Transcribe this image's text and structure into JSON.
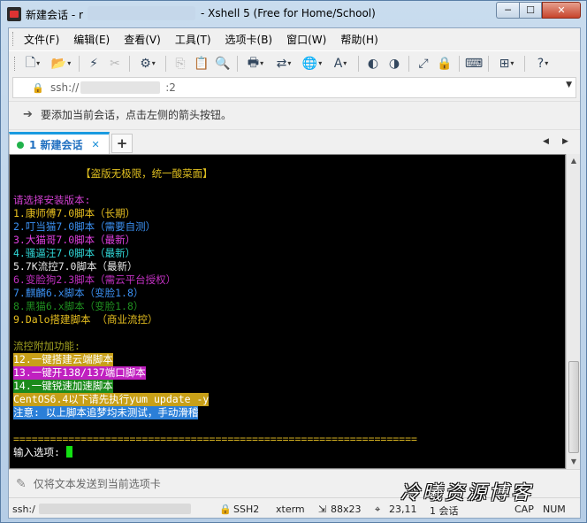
{
  "window": {
    "title_left": "新建会话 - r",
    "title_right": "- Xshell 5 (Free for Home/School)",
    "min_glyph": "─",
    "max_glyph": "☐",
    "close_glyph": "✕"
  },
  "menu": [
    "文件(F)",
    "编辑(E)",
    "查看(V)",
    "工具(T)",
    "选项卡(B)",
    "窗口(W)",
    "帮助(H)"
  ],
  "address": {
    "value": "ssh://",
    "tail": ":2"
  },
  "hint": {
    "text": "要添加当前会话，点击左侧的箭头按钮。"
  },
  "tab": {
    "label": "1 新建会话",
    "close": "✕",
    "add": "+"
  },
  "terminal": {
    "lines": [
      {
        "text": "           【盗版无极限，统一酸菜面】",
        "color": "#e0c020",
        "bg": ""
      },
      {
        "text": "",
        "color": "#ffffff",
        "bg": ""
      },
      {
        "text": "请选择安装版本:",
        "color": "#d040d0",
        "bg": ""
      },
      {
        "text": "1.康师傅7.0脚本（长期）",
        "color": "#e8c020",
        "bg": ""
      },
      {
        "text": "2.叮当猫7.0脚本（需要自测）",
        "color": "#3b8ff0",
        "bg": ""
      },
      {
        "text": "3.大猫哥7.0脚本（最新）",
        "color": "#e040e0",
        "bg": ""
      },
      {
        "text": "4.骚逼汪7.0脚本（最新）",
        "color": "#30d8d8",
        "bg": ""
      },
      {
        "text": "5.7K流控7.0脚本（最新）",
        "color": "#e8e8e8",
        "bg": ""
      },
      {
        "text": "6.变脸狗2.3脚本（需云平台授权）",
        "color": "#c030c0",
        "bg": ""
      },
      {
        "text": "7.麒麟6.x脚本（变脸1.8）",
        "color": "#3b8ff0",
        "bg": ""
      },
      {
        "text": "8.黑猫6.x脚本（变脸1.8）",
        "color": "#1f8f1f",
        "bg": ""
      },
      {
        "text": "9.Dalo搭建脚本 （商业流控）",
        "color": "#e8c020",
        "bg": ""
      },
      {
        "text": "",
        "color": "#ffffff",
        "bg": ""
      },
      {
        "text": "流控附加功能:",
        "color": "#a0a020",
        "bg": ""
      },
      {
        "text": "12.一键搭建云端脚本",
        "color": "#ffffff",
        "bg": "#c8a018"
      },
      {
        "text": "13.一键开138/137端口脚本",
        "color": "#ffffff",
        "bg": "#c020c0"
      },
      {
        "text": "14.一键锐速加速脚本",
        "color": "#ffffff",
        "bg": "#1c8a1c"
      },
      {
        "text": "CentOS6.4以下请先执行yum update -y",
        "color": "#ffffff",
        "bg": "#c8a018"
      },
      {
        "text": "注意: 以上脚本追梦均未测试，手动滑稽",
        "color": "#ffffff",
        "bg": "#2b7fd8"
      },
      {
        "text": "",
        "color": "#ffffff",
        "bg": ""
      },
      {
        "text": "==================================================================",
        "color": "#d4b020",
        "bg": ""
      },
      {
        "text": "输入选项: ",
        "color": "#ffffff",
        "bg": ""
      }
    ]
  },
  "send": {
    "placeholder": "仅将文本发送到当前选项卡"
  },
  "status": {
    "left": "ssh:/",
    "proto": "SSH2",
    "term": "xterm",
    "size": "88x23",
    "pos": "23,11",
    "sessions": "1 会话",
    "caps": "CAP",
    "num": "NUM"
  },
  "watermark": "冷曦资源博客",
  "colors": {
    "tab_accent": "#1a9be0",
    "terminal_bg": "#000000",
    "cursor": "#13e013"
  }
}
